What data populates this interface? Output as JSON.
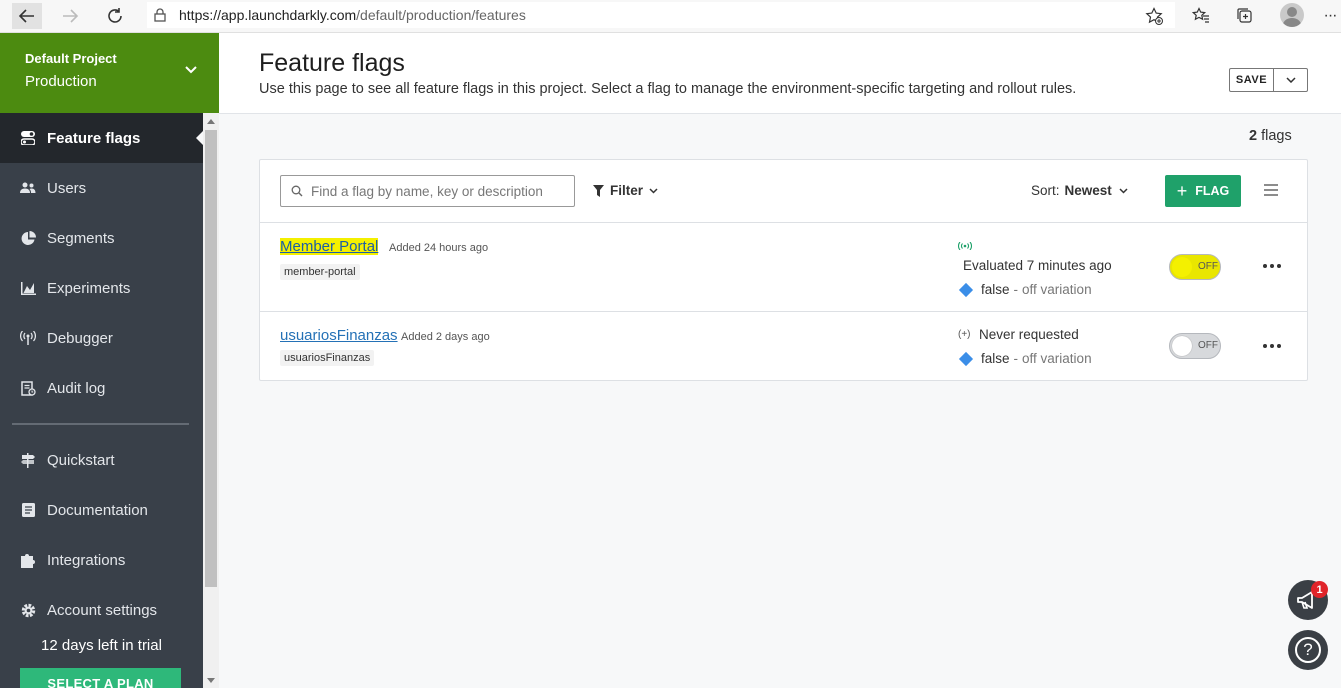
{
  "browser": {
    "url_host": "https://app.launchdarkly.com",
    "url_path": "/default/production/features"
  },
  "sidebar": {
    "project_name": "Default Project",
    "environment": "Production",
    "items": [
      {
        "label": "Feature flags",
        "icon": "toggle-icon",
        "active": true
      },
      {
        "label": "Users",
        "icon": "users-icon"
      },
      {
        "label": "Segments",
        "icon": "pie-chart-icon"
      },
      {
        "label": "Experiments",
        "icon": "area-chart-icon"
      },
      {
        "label": "Debugger",
        "icon": "broadcast-icon"
      },
      {
        "label": "Audit log",
        "icon": "audit-log-icon"
      },
      {
        "label": "Quickstart",
        "icon": "signpost-icon"
      },
      {
        "label": "Documentation",
        "icon": "document-icon"
      },
      {
        "label": "Integrations",
        "icon": "puzzle-icon"
      },
      {
        "label": "Account settings",
        "icon": "gear-icon"
      }
    ],
    "trial_text": "12 days left in trial",
    "select_plan": "SELECT A PLAN"
  },
  "header": {
    "title": "Feature flags",
    "description": "Use this page to see all feature flags in this project. Select a flag to manage the environment-specific targeting and rollout rules.",
    "save_label": "SAVE"
  },
  "flag_count": {
    "number": "2",
    "unit": "flags"
  },
  "toolbar": {
    "search_placeholder": "Find a flag by name, key or description",
    "filter_label": "Filter",
    "sort_label": "Sort:",
    "sort_value": "Newest",
    "add_flag_label": "FLAG"
  },
  "flags": [
    {
      "name": "Member Portal",
      "added": "Added 24 hours ago",
      "key": "member-portal",
      "status": "Evaluated 7 minutes ago",
      "variation_value": "false",
      "variation_desc": "off variation",
      "toggle": "OFF",
      "highlighted": true
    },
    {
      "name": "usuariosFinanzas",
      "added": "Added 2 days ago",
      "key": "usuariosFinanzas",
      "status_icon": "(+)",
      "status": "Never requested",
      "variation_value": "false",
      "variation_desc": "off variation",
      "toggle": "OFF",
      "highlighted": false
    }
  ],
  "notifications": {
    "badge": "1",
    "help": "?"
  },
  "colors": {
    "brand_green": "#4c8b10",
    "sidebar_bg": "#394049",
    "primary_button": "#1fa16a",
    "highlight": "#f4f000",
    "link": "#2471b6"
  }
}
